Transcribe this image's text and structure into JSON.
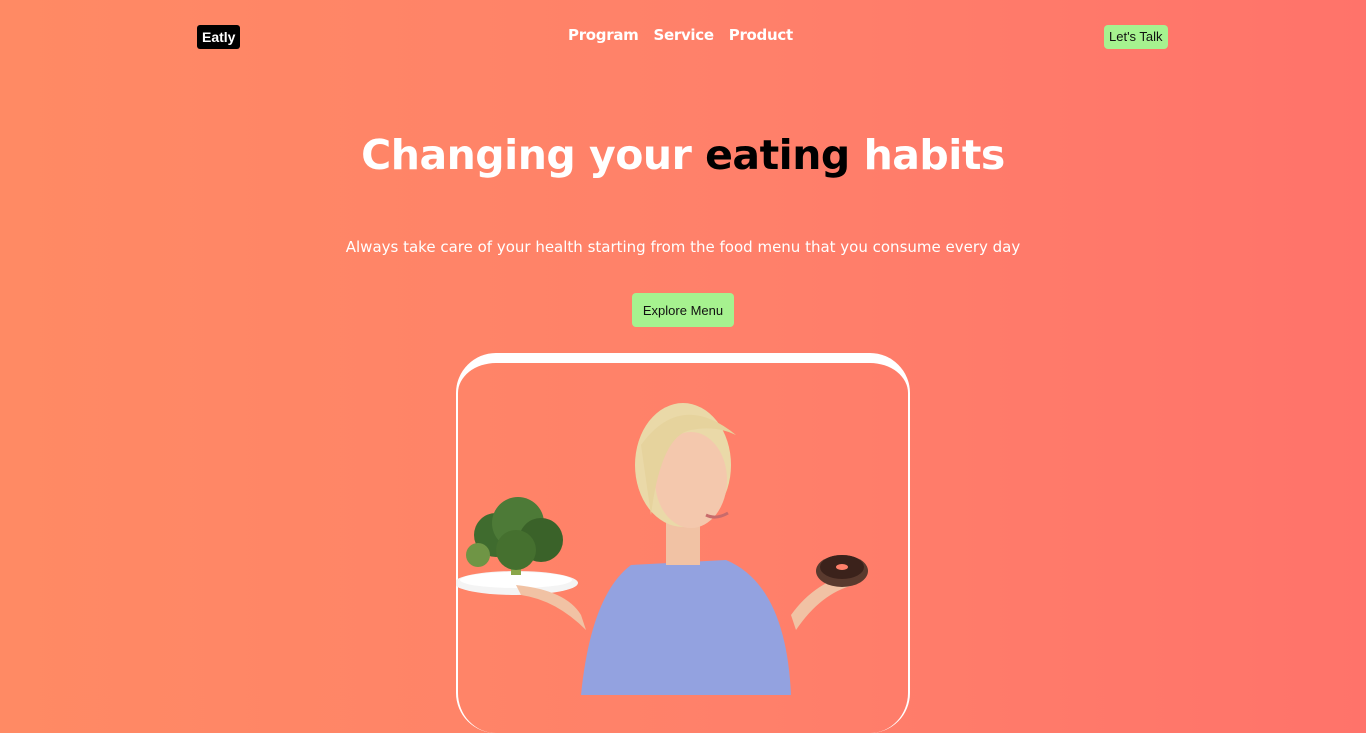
{
  "header": {
    "logo": "Eatly",
    "nav": [
      "Program",
      "Service",
      "Product"
    ],
    "cta_label": "Let's Talk"
  },
  "hero": {
    "title_before": "Changing your",
    "title_highlight": "eating",
    "title_after": "habits",
    "subtitle": "Always take care of your health starting from the food menu that you consume every day",
    "button_label": "Explore Menu"
  },
  "colors": {
    "background_start": "#ff8a64",
    "background_end": "#ff736a",
    "accent_green": "#a6f28f",
    "logo_bg": "#000000"
  }
}
